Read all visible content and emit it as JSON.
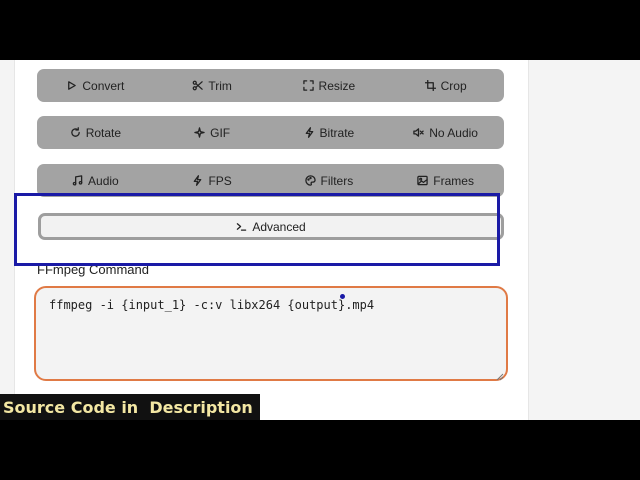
{
  "toolbar": {
    "row1": [
      {
        "label": "Convert",
        "icon": "play-icon"
      },
      {
        "label": "Trim",
        "icon": "scissors-icon"
      },
      {
        "label": "Resize",
        "icon": "resize-icon"
      },
      {
        "label": "Crop",
        "icon": "crop-icon"
      }
    ],
    "row2": [
      {
        "label": "Rotate",
        "icon": "rotate-icon"
      },
      {
        "label": "GIF",
        "icon": "sparkle-icon"
      },
      {
        "label": "Bitrate",
        "icon": "lightning-icon"
      },
      {
        "label": "No Audio",
        "icon": "speaker-mute-icon"
      }
    ],
    "row3": [
      {
        "label": "Audio",
        "icon": "music-note-icon"
      },
      {
        "label": "FPS",
        "icon": "lightning-icon"
      },
      {
        "label": "Filters",
        "icon": "palette-icon"
      },
      {
        "label": "Frames",
        "icon": "image-icon"
      }
    ],
    "advanced": {
      "label": "Advanced",
      "icon": "terminal-icon"
    }
  },
  "command": {
    "label": "FFmpeg Command",
    "value": "ffmpeg -i {input_1} -c:v libx264 {output}.mp4"
  },
  "banner": {
    "text": "Source Code in  Description"
  },
  "colors": {
    "tab_background": "#a3a3a3",
    "highlight_border": "#1a1aa6",
    "field_border": "#e07a45",
    "banner_text": "#f3e7a3"
  }
}
